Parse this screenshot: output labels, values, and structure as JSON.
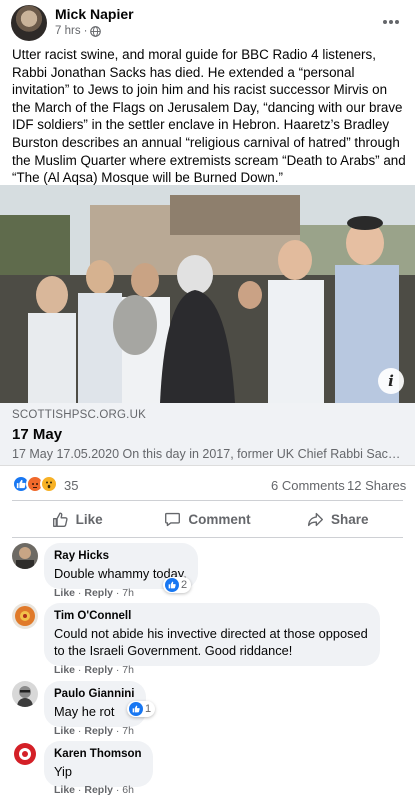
{
  "post": {
    "author": "Mick Napier",
    "time": "7 hrs",
    "separator": "·",
    "text": "Utter racist swine, and moral guide for BBC Radio 4 listeners, Rabbi Jonathan Sacks has died. He extended a “personal invitation” to Jews to join him and his racist successor Mirvis on the March of the Flags on Jerusalem Day, “dancing with our brave IDF soldiers” in the settler enclave in Hebron. Haaretz’s Bradley Burston describes an annual “religious carnival of hatred” through the Muslim Quarter where extremists scream “Death to Arabs” and “The (Al Aqsa) Mosque will be Burned Down.”"
  },
  "link": {
    "domain": "SCOTTISHPSC.ORG.UK",
    "title": "17 May",
    "description": "17 May 17.05.2020 On this day in 2017, former UK Chief Rabbi Sac…"
  },
  "stats": {
    "reaction_count": "35",
    "comments": "6 Comments",
    "shares": "12 Shares"
  },
  "actions": {
    "like": "Like",
    "comment": "Comment",
    "share": "Share"
  },
  "comments": [
    {
      "name": "Ray Hicks",
      "text": "Double whammy today.",
      "like": "Like",
      "reply": "Reply",
      "time": "7h",
      "reactions": "2"
    },
    {
      "name": "Tim O'Connell",
      "text": "Could not abide his invective directed at those opposed to the Israeli Government. Good riddance!",
      "like": "Like",
      "reply": "Reply",
      "time": "7h"
    },
    {
      "name": "Paulo Giannini",
      "text": "May he rot",
      "like": "Like",
      "reply": "Reply",
      "time": "7h",
      "reactions": "1"
    },
    {
      "name": "Karen Thomson",
      "text": "Yip",
      "like": "Like",
      "reply": "Reply",
      "time": "6h"
    }
  ],
  "colors": {
    "accent": "#1877f2",
    "secondary_text": "#65676b",
    "bubble": "#f0f2f5"
  },
  "icons": [
    "globe-icon",
    "more-icon",
    "info-icon",
    "like-icon",
    "comment-icon",
    "share-icon",
    "angry-icon",
    "wow-icon"
  ]
}
